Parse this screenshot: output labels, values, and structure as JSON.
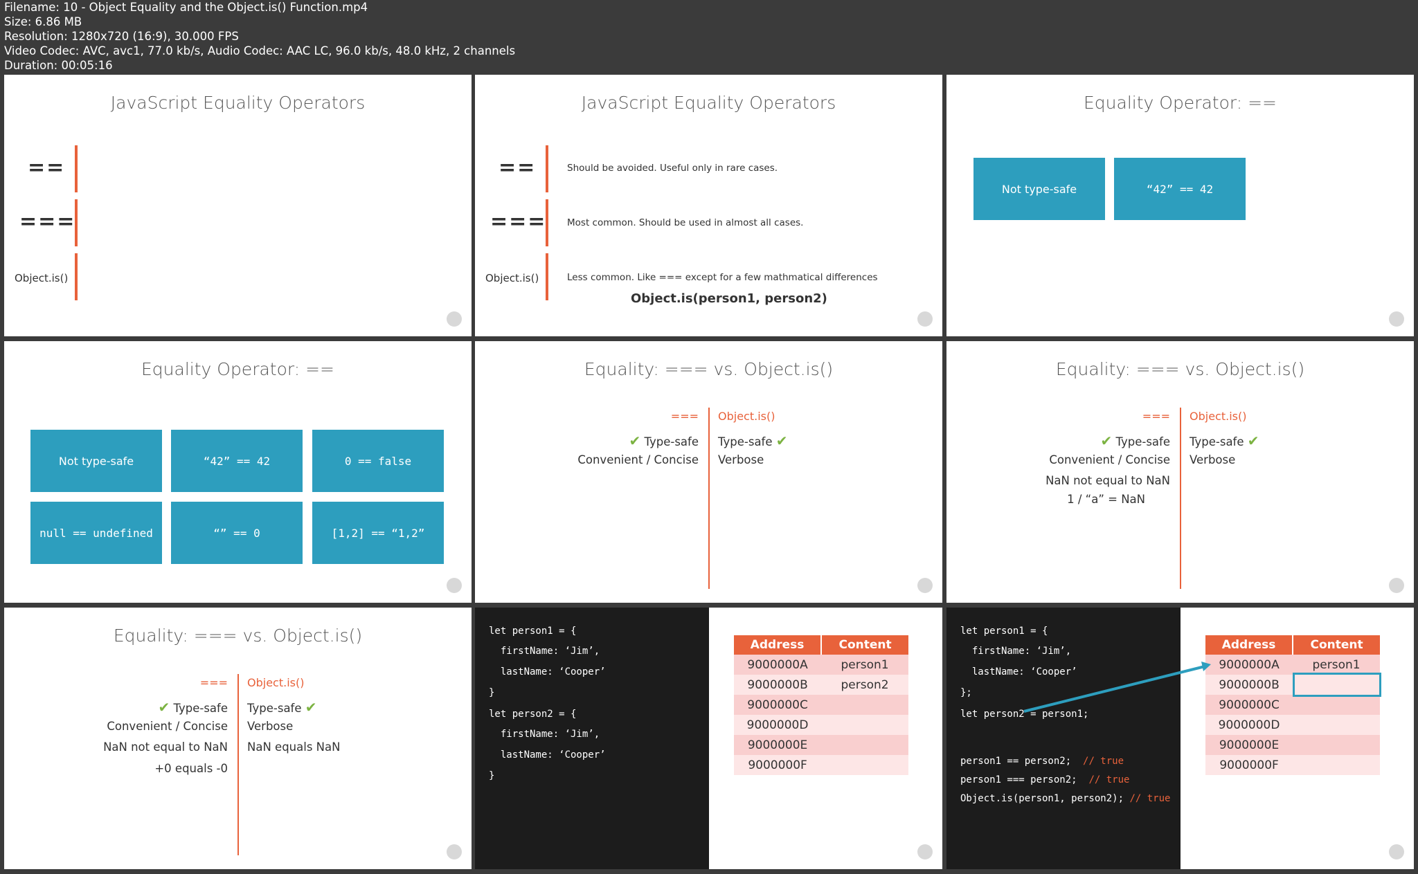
{
  "header": {
    "lines": [
      "Filename: 10 - Object Equality and the Object.is() Function.mp4",
      "Size: 6.86 MB",
      "Resolution: 1280x720 (16:9), 30.000 FPS",
      "Video Codec: AVC, avc1, 77.0 kb/s, Audio Codec: AAC LC, 96.0 kb/s, 48.0 kHz, 2 channels",
      "Duration: 00:05:16"
    ]
  },
  "slide1": {
    "title": "JavaScript Equality Operators",
    "ops": [
      "==",
      "===",
      "Object.is()"
    ]
  },
  "slide2": {
    "title": "JavaScript Equality Operators",
    "ops": [
      "==",
      "===",
      "Object.is()"
    ],
    "descs": [
      "Should be avoided. Useful only in rare cases.",
      "Most common. Should be used in almost all cases.",
      "Less common. Like === except for a few mathmatical differences"
    ],
    "example": "Object.is(person1, person2)"
  },
  "slide3": {
    "title": "Equality Operator: ==",
    "boxes": [
      "Not type-safe",
      "“42” == 42"
    ]
  },
  "slide4": {
    "title": "Equality Operator: ==",
    "boxes": [
      "Not type-safe",
      "“42” == 42",
      "0 == false",
      "null == undefined",
      "“” == 0",
      "[1,2] == “1,2”"
    ]
  },
  "slide5": {
    "title": "Equality: === vs. Object.is()",
    "left_head": "===",
    "right_head": "Object.is()",
    "left": [
      "Type-safe",
      "Convenient / Concise"
    ],
    "right": [
      "Type-safe",
      "Verbose"
    ]
  },
  "slide6": {
    "title": "Equality: === vs. Object.is()",
    "left_head": "===",
    "right_head": "Object.is()",
    "left": [
      "Type-safe",
      "Convenient / Concise",
      "NaN not equal to NaN",
      "1 / “a” = NaN"
    ],
    "right": [
      "Type-safe",
      "Verbose"
    ]
  },
  "slide7": {
    "title": "Equality: === vs. Object.is()",
    "left_head": "===",
    "right_head": "Object.is()",
    "left": [
      "Type-safe",
      "Convenient / Concise",
      "NaN not equal to NaN",
      "+0 equals -0"
    ],
    "right": [
      "Type-safe",
      "Verbose",
      "NaN equals NaN"
    ]
  },
  "slide8": {
    "code": [
      "let person1 = {",
      "  firstName: ‘Jim’,",
      "  lastName: ‘Cooper’",
      "}",
      "let person2 = {",
      "  firstName: ‘Jim’,",
      "  lastName: ‘Cooper’",
      "}"
    ],
    "table_headers": [
      "Address",
      "Content"
    ],
    "rows": [
      [
        "9000000A",
        "person1"
      ],
      [
        "9000000B",
        "person2"
      ],
      [
        "9000000C",
        ""
      ],
      [
        "9000000D",
        ""
      ],
      [
        "9000000E",
        ""
      ],
      [
        "9000000F",
        ""
      ]
    ]
  },
  "slide9": {
    "code": [
      "let person1 = {",
      "  firstName: ‘Jim’,",
      "  lastName: ‘Cooper’",
      "};",
      "let person2 = person1;"
    ],
    "compare": [
      {
        "code": "person1 == person2;",
        "comment": "// true"
      },
      {
        "code": "person1 === person2;",
        "comment": "// true"
      },
      {
        "code": "Object.is(person1, person2);",
        "comment": "// true"
      }
    ],
    "table_headers": [
      "Address",
      "Content"
    ],
    "rows": [
      [
        "9000000A",
        "person1"
      ],
      [
        "9000000B",
        ""
      ],
      [
        "9000000C",
        ""
      ],
      [
        "9000000D",
        ""
      ],
      [
        "9000000E",
        ""
      ],
      [
        "9000000F",
        ""
      ]
    ]
  },
  "colors": {
    "accent": "#e8623b",
    "box": "#2d9ebe",
    "check": "#7cb342",
    "highlight": "#2d9ebe"
  },
  "icons": {
    "check": "check-icon",
    "watermark": "watermark-icon",
    "arrow": "reference-arrow-icon"
  }
}
